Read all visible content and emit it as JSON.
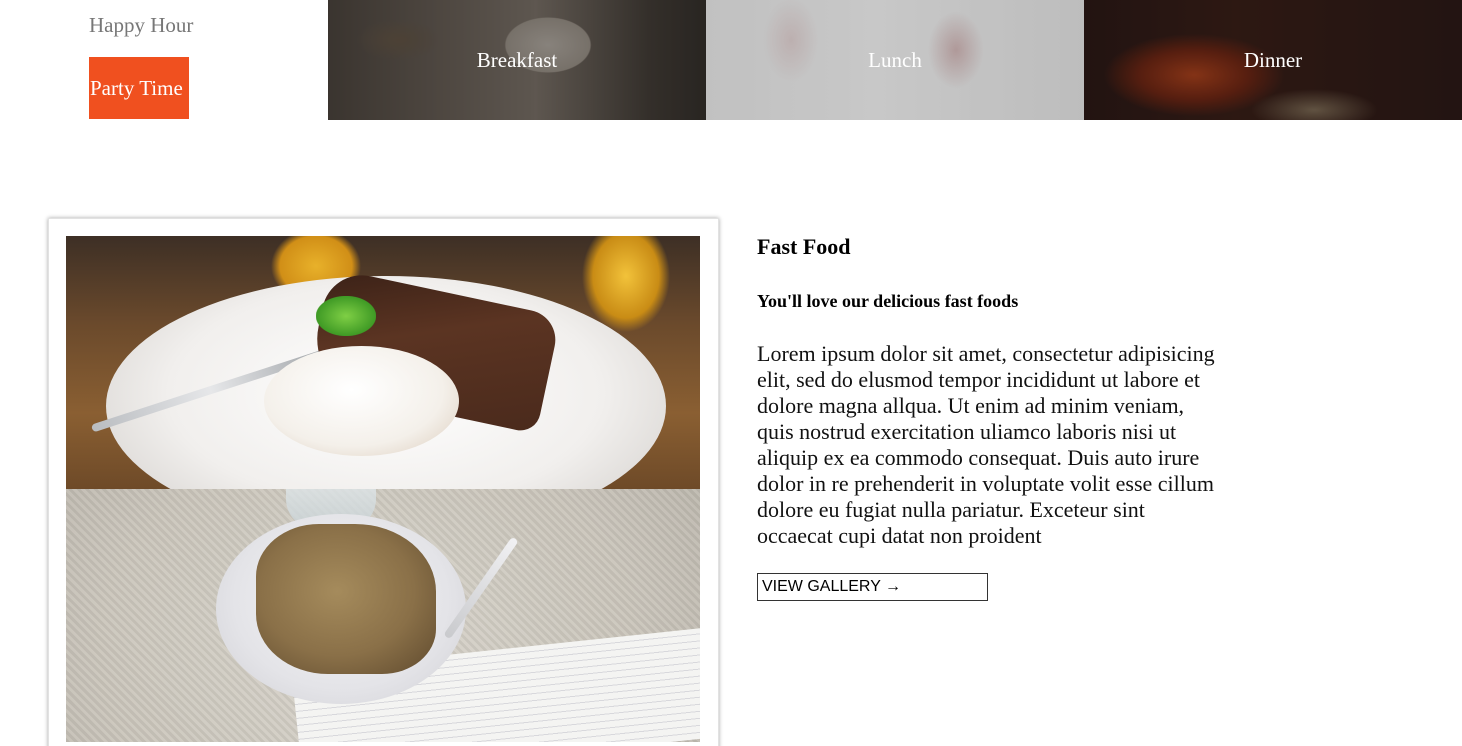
{
  "menu": {
    "happy_hour": "Happy Hour",
    "party_time": "Party Time",
    "accent_color": "#f0501f"
  },
  "meal_tiles": [
    {
      "label": "Breakfast"
    },
    {
      "label": "Lunch"
    },
    {
      "label": "Dinner"
    }
  ],
  "feature": {
    "title": "Fast Food",
    "subtitle": "You'll love our delicious fast foods",
    "body": "Lorem ipsum dolor sit amet, consectetur adipisicing elit, sed do elusmod tempor incididunt ut labore et dolore magna allqua. Ut enim ad minim veniam, quis nostrud exercitation uliamco laboris nisi ut aliquip ex ea commodo consequat. Duis auto irure dolor in re prehenderit in voluptate volit esse cillum dolore eu fugiat nulla pariatur. Exceteur sint occaecat cupi datat non proident",
    "button_label": "VIEW GALLERY →"
  }
}
